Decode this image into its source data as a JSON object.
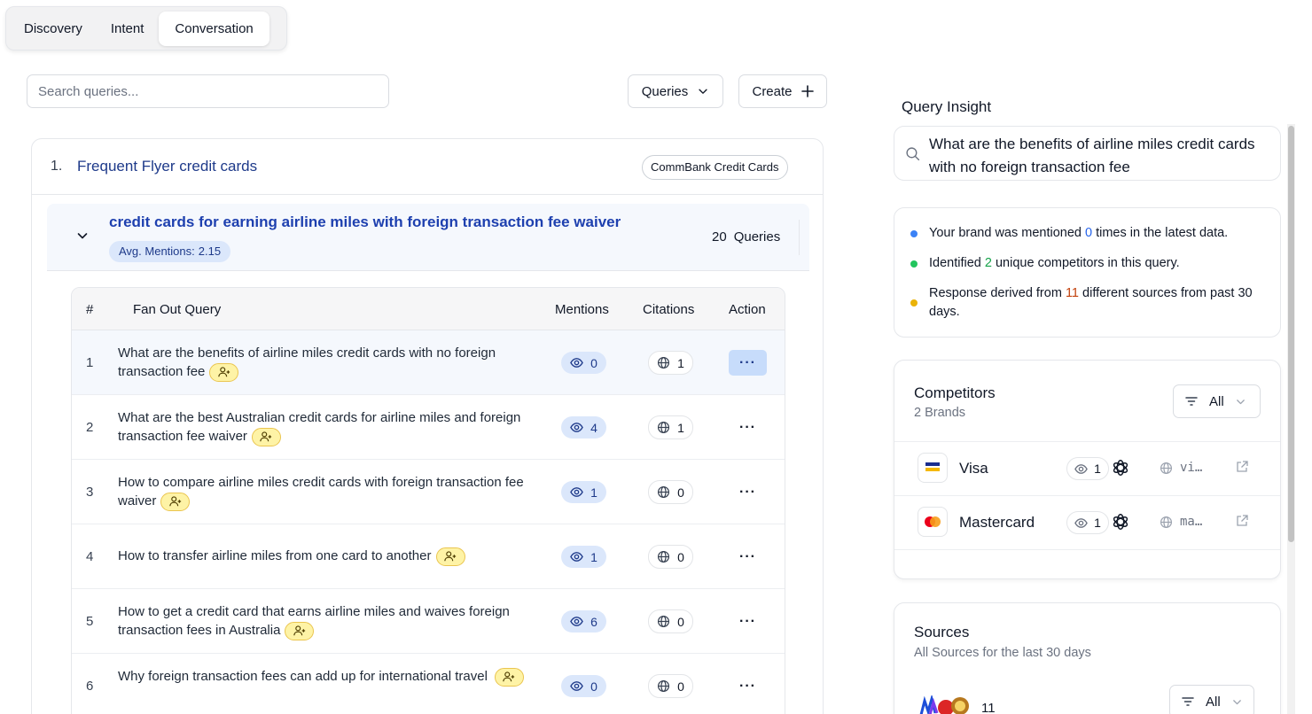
{
  "tabs": [
    "Discovery",
    "Intent",
    "Conversation"
  ],
  "search": {
    "placeholder": "Search queries..."
  },
  "toolbar": {
    "queries_label": "Queries",
    "create_label": "Create"
  },
  "topic": {
    "number": "1.",
    "title": "Frequent Flyer credit cards",
    "brand": "CommBank Credit Cards"
  },
  "group": {
    "title": "credit cards for earning airline miles with foreign transaction fee waiver",
    "avg_label": "Avg. Mentions:",
    "avg_value": "2.15",
    "query_count": "20",
    "query_count_label": "Queries"
  },
  "table": {
    "columns": [
      "#",
      "Fan Out Query",
      "Mentions",
      "Citations",
      "Action"
    ],
    "rows": [
      {
        "num": "1",
        "query": "What are the benefits of airline miles credit cards with no foreign transaction fee",
        "mentions": "0",
        "citations": "1"
      },
      {
        "num": "2",
        "query": "What are the best Australian credit cards for airline miles and foreign transaction fee waiver",
        "mentions": "4",
        "citations": "1"
      },
      {
        "num": "3",
        "query": "How to compare airline miles credit cards with foreign transaction fee waiver",
        "mentions": "1",
        "citations": "0"
      },
      {
        "num": "4",
        "query": "How to transfer airline miles from one card to another",
        "mentions": "1",
        "citations": "0"
      },
      {
        "num": "5",
        "query": "How to get a credit card that earns airline miles and waives foreign transaction fees in Australia",
        "mentions": "6",
        "citations": "0"
      },
      {
        "num": "6",
        "query": "Why foreign transaction fees can add up for international travel",
        "mentions": "0",
        "citations": "0"
      }
    ]
  },
  "insight": {
    "title": "Query Insight",
    "query": "What are the benefits of airline miles credit cards with no foreign transaction fee",
    "stats": [
      {
        "pre": "Your brand was mentioned ",
        "value": "0",
        "post": " times in the latest data."
      },
      {
        "pre": "Identified ",
        "value": "2",
        "post": " unique competitors in this query."
      },
      {
        "pre": "Response derived from ",
        "value": "11",
        "post": " different sources from past 30 days."
      }
    ]
  },
  "competitors": {
    "title": "Competitors",
    "subtitle": "2 Brands",
    "filter": "All",
    "brands": [
      {
        "name": "Visa",
        "mentions": "1",
        "site": "vi…"
      },
      {
        "name": "Mastercard",
        "mentions": "1",
        "site": "ma…"
      }
    ]
  },
  "sources": {
    "title": "Sources",
    "subtitle": "All Sources for the last 30 days",
    "count": "11",
    "filter": "All"
  },
  "colors": {
    "accent": "#1e40af",
    "mention_badge_bg": "#dbe7fb",
    "assign_badge_bg": "#fef3a6",
    "dot_blue": "#3b82f6",
    "dot_green": "#22c55e",
    "dot_yellow": "#eab308",
    "value_orange": "#c2410c"
  },
  "icons": [
    "search-icon",
    "chevron-down-icon",
    "plus-icon",
    "eye-icon",
    "globe-icon",
    "user-plus-icon",
    "more-icon",
    "filter-icon",
    "openai-icon",
    "external-link-icon"
  ]
}
